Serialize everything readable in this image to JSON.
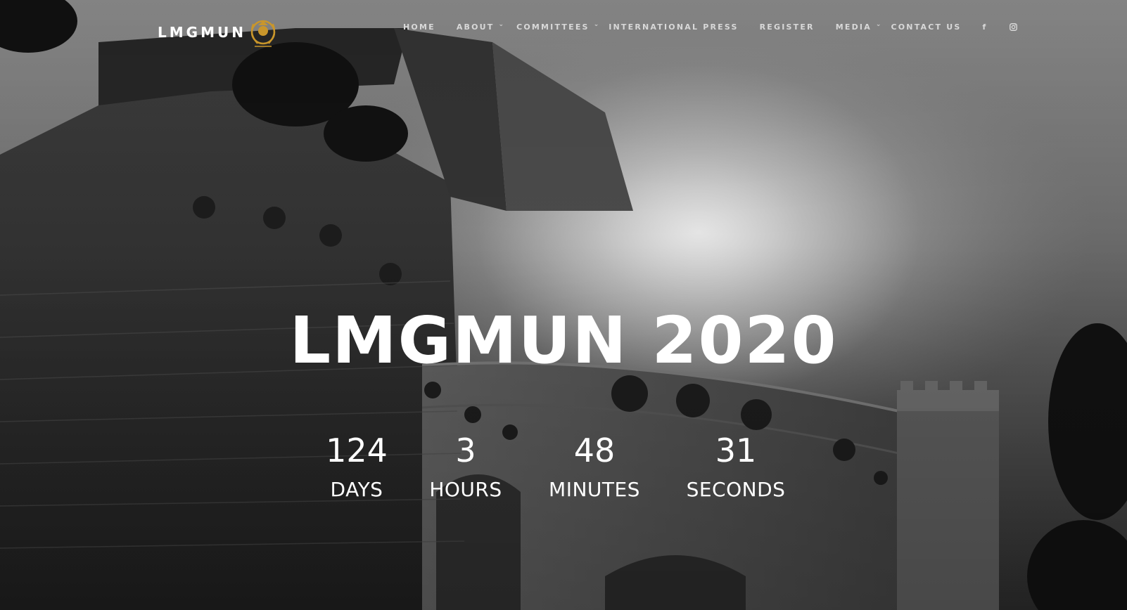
{
  "header": {
    "brand": "LMGMUN",
    "nav": [
      {
        "label": "HOME",
        "has_dropdown": false
      },
      {
        "label": "ABOUT",
        "has_dropdown": true
      },
      {
        "label": "COMMITTEES",
        "has_dropdown": true
      },
      {
        "label": "INTERNATIONAL PRESS",
        "has_dropdown": false
      },
      {
        "label": "REGISTER",
        "has_dropdown": false
      },
      {
        "label": "MEDIA",
        "has_dropdown": true
      },
      {
        "label": "CONTACT US",
        "has_dropdown": false
      }
    ],
    "social": {
      "facebook": "f",
      "instagram": "instagram-icon"
    }
  },
  "hero": {
    "title": "LMGMUN 2020"
  },
  "countdown": [
    {
      "value": "124",
      "label": "DAYS"
    },
    {
      "value": "3",
      "label": "HOURS"
    },
    {
      "value": "48",
      "label": "MINUTES"
    },
    {
      "value": "31",
      "label": "SECONDS"
    }
  ],
  "colors": {
    "text": "#ffffff",
    "nav_text": "#d8d8d8",
    "logo_gold": "#c9962b"
  }
}
